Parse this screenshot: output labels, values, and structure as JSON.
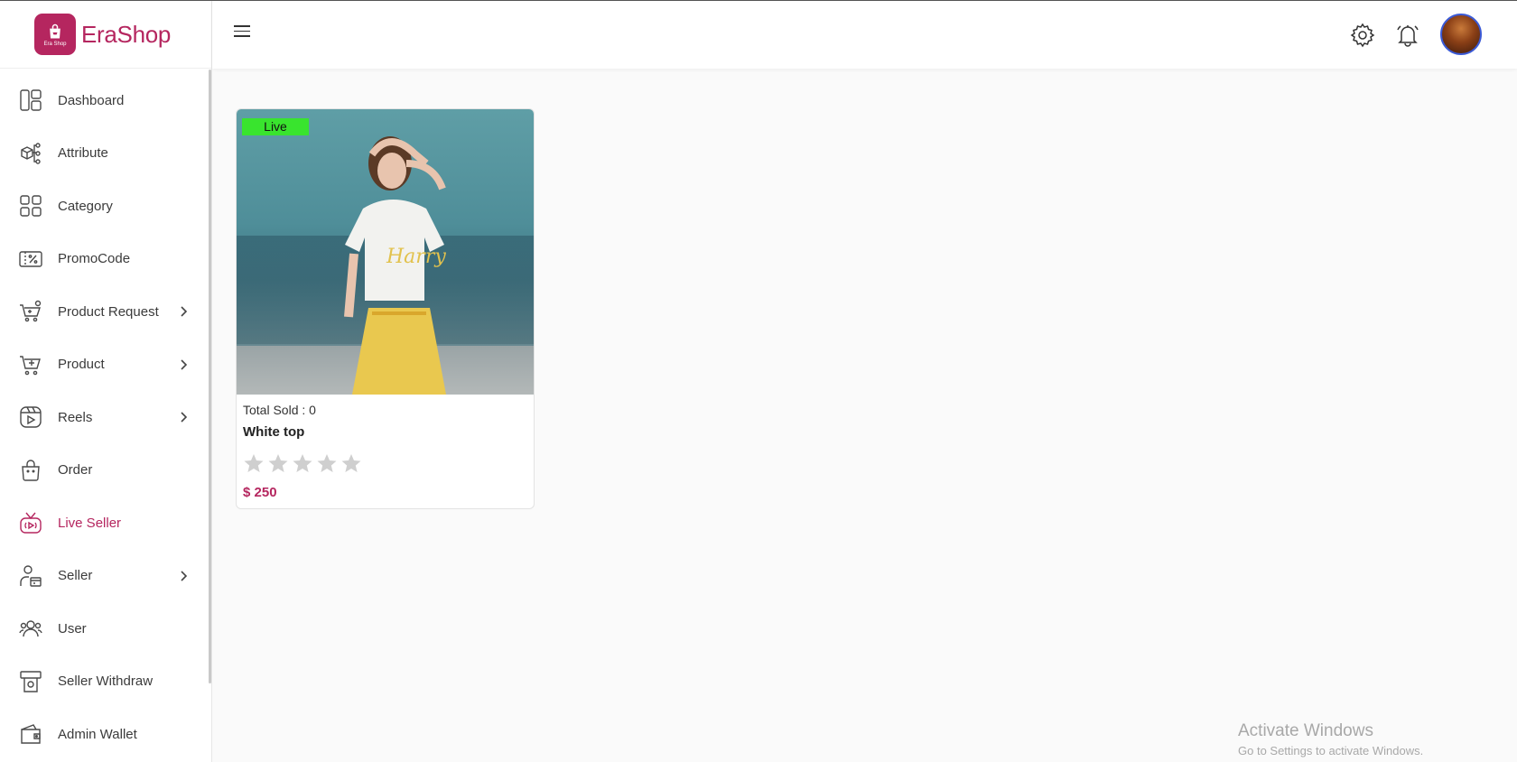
{
  "brand": {
    "name": "EraShop",
    "logo_text": "Era Shop",
    "color": "#b5265f"
  },
  "sidebar": {
    "items": [
      {
        "label": "Dashboard",
        "icon": "dashboard-icon",
        "has_submenu": false,
        "active": false
      },
      {
        "label": "Attribute",
        "icon": "attribute-icon",
        "has_submenu": false,
        "active": false
      },
      {
        "label": "Category",
        "icon": "category-icon",
        "has_submenu": false,
        "active": false
      },
      {
        "label": "PromoCode",
        "icon": "promocode-icon",
        "has_submenu": false,
        "active": false
      },
      {
        "label": "Product Request",
        "icon": "product-request-icon",
        "has_submenu": true,
        "active": false
      },
      {
        "label": "Product",
        "icon": "product-icon",
        "has_submenu": true,
        "active": false
      },
      {
        "label": "Reels",
        "icon": "reels-icon",
        "has_submenu": true,
        "active": false
      },
      {
        "label": "Order",
        "icon": "order-icon",
        "has_submenu": false,
        "active": false
      },
      {
        "label": "Live Seller",
        "icon": "live-seller-icon",
        "has_submenu": false,
        "active": true
      },
      {
        "label": "Seller",
        "icon": "seller-icon",
        "has_submenu": true,
        "active": false
      },
      {
        "label": "User",
        "icon": "user-icon",
        "has_submenu": false,
        "active": false
      },
      {
        "label": "Seller Withdraw",
        "icon": "seller-withdraw-icon",
        "has_submenu": false,
        "active": false
      },
      {
        "label": "Admin Wallet",
        "icon": "admin-wallet-icon",
        "has_submenu": false,
        "active": false
      }
    ]
  },
  "header": {
    "menu_icon": "hamburger-icon",
    "settings_icon": "gear-icon",
    "notification_icon": "bell-icon",
    "avatar_icon": "avatar"
  },
  "product_card": {
    "badge": "Live",
    "badge_color": "#39e42e",
    "total_sold": "Total Sold : 0",
    "name": "White top",
    "rating": 0,
    "rating_max": 5,
    "price": "$ 250"
  },
  "watermark": {
    "title": "Activate Windows",
    "subtitle": "Go to Settings to activate Windows."
  }
}
